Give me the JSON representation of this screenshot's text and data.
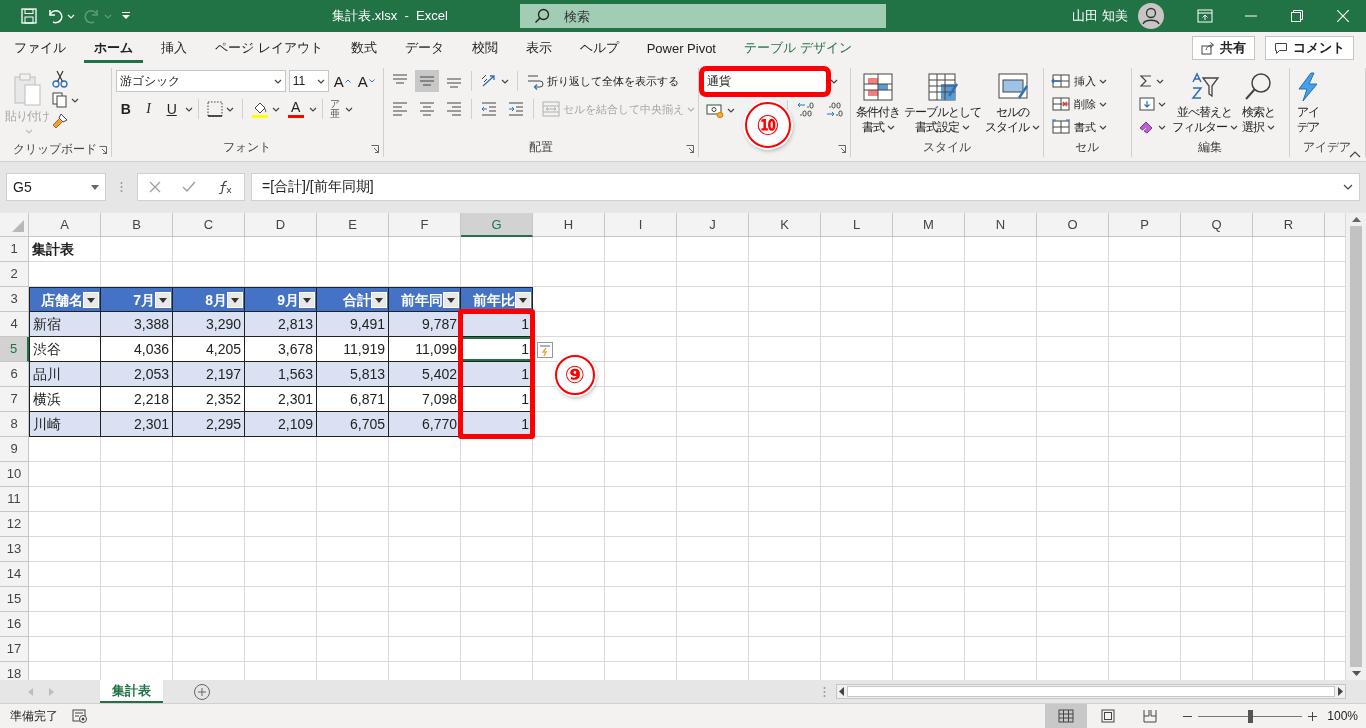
{
  "title_bar": {
    "title": "集計表.xlsx  -  Excel",
    "search_placeholder": "検索",
    "user_name": "山田 知美"
  },
  "menu_tabs": [
    {
      "label": "ファイル",
      "selected": false,
      "kind": "tab"
    },
    {
      "label": "ホーム",
      "selected": true,
      "kind": "tab"
    },
    {
      "label": "挿入",
      "selected": false,
      "kind": "tab"
    },
    {
      "label": "ページ レイアウト",
      "selected": false,
      "kind": "tab"
    },
    {
      "label": "数式",
      "selected": false,
      "kind": "tab"
    },
    {
      "label": "データ",
      "selected": false,
      "kind": "tab"
    },
    {
      "label": "校閲",
      "selected": false,
      "kind": "tab"
    },
    {
      "label": "表示",
      "selected": false,
      "kind": "tab"
    },
    {
      "label": "ヘルプ",
      "selected": false,
      "kind": "tab"
    },
    {
      "label": "Power Pivot",
      "selected": false,
      "kind": "tab"
    },
    {
      "label": "テーブル デザイン",
      "selected": false,
      "kind": "contextual"
    }
  ],
  "share_button": "共有",
  "comment_button": "コメント",
  "ribbon": {
    "clipboard": {
      "paste_label": "貼り付け",
      "paste_disabled": true,
      "group_label": "クリップボード"
    },
    "font": {
      "font_name": "游ゴシック",
      "font_size": "11",
      "grow_label": "A",
      "shrink_label": "A",
      "bold_label": "B",
      "italic_label": "I",
      "underline_label": "U",
      "font_color_label": "A",
      "phonetic_labels": [
        "ア",
        "亜"
      ],
      "group_label": "フォント"
    },
    "alignment": {
      "vertical_buttons": [
        {
          "kind": "top",
          "selected": false
        },
        {
          "kind": "middle",
          "selected": true
        },
        {
          "kind": "bottom",
          "selected": false
        }
      ],
      "wrap_label": "折り返して全体を表示する",
      "merge_label": "セルを結合して中央揃え",
      "merge_disabled": true,
      "group_label": "配置"
    },
    "number": {
      "format": "通貨",
      "highlighted": true
    },
    "styles": {
      "buttons": [
        {
          "kind": "conditional",
          "lines": [
            "条件付き",
            "書式"
          ]
        },
        {
          "kind": "table",
          "lines": [
            "テーブルとして",
            "書式設定"
          ]
        },
        {
          "kind": "cell",
          "lines": [
            "セルの",
            "スタイル"
          ]
        }
      ],
      "group_label": "スタイル"
    },
    "cells": {
      "buttons": [
        {
          "kind": "insert",
          "label": "挿入"
        },
        {
          "kind": "delete",
          "label": "削除"
        },
        {
          "kind": "format",
          "label": "書式"
        }
      ],
      "group_label": "セル"
    },
    "editing": {
      "sort_lines": [
        "並べ替えと",
        "フィルター"
      ],
      "find_lines": [
        "検索と",
        "選択"
      ],
      "group_label": "編集"
    },
    "ideas": {
      "lines": [
        "アイ",
        "デア"
      ],
      "group_label": "アイデア"
    }
  },
  "formula_bar": {
    "name_box": "G5",
    "formula": "=[合計]/[前年同期]"
  },
  "sheet": {
    "columns": [
      {
        "letter": "A",
        "selected": false
      },
      {
        "letter": "B",
        "selected": false
      },
      {
        "letter": "C",
        "selected": false
      },
      {
        "letter": "D",
        "selected": false
      },
      {
        "letter": "E",
        "selected": false
      },
      {
        "letter": "F",
        "selected": false
      },
      {
        "letter": "G",
        "selected": true
      },
      {
        "letter": "H",
        "selected": false
      },
      {
        "letter": "I",
        "selected": false
      },
      {
        "letter": "J",
        "selected": false
      },
      {
        "letter": "K",
        "selected": false
      },
      {
        "letter": "L",
        "selected": false
      },
      {
        "letter": "M",
        "selected": false
      },
      {
        "letter": "N",
        "selected": false
      },
      {
        "letter": "O",
        "selected": false
      },
      {
        "letter": "P",
        "selected": false
      },
      {
        "letter": "Q",
        "selected": false
      },
      {
        "letter": "R",
        "selected": false
      }
    ],
    "rows": [
      {
        "number": "1",
        "selected": false,
        "cells": [
          {
            "kind": "title",
            "text": "集計表",
            "selected": false
          }
        ]
      },
      {
        "number": "2",
        "selected": false
      },
      {
        "number": "3",
        "selected": false,
        "cells": [
          {
            "kind": "header",
            "text": "店舗名",
            "selected": false
          },
          {
            "kind": "header",
            "text": "7月",
            "selected": false
          },
          {
            "kind": "header",
            "text": "8月",
            "selected": false
          },
          {
            "kind": "header",
            "text": "9月",
            "selected": false
          },
          {
            "kind": "header",
            "text": "合計",
            "selected": false
          },
          {
            "kind": "header",
            "text": "前年同",
            "selected": false
          },
          {
            "kind": "header",
            "text": "前年比",
            "selected": false
          }
        ]
      },
      {
        "number": "4",
        "selected": false,
        "banded": true,
        "cells": [
          {
            "kind": "text",
            "text": "新宿",
            "selected": false
          },
          {
            "kind": "number",
            "text": "3,388",
            "selected": false
          },
          {
            "kind": "number",
            "text": "3,290",
            "selected": false
          },
          {
            "kind": "number",
            "text": "2,813",
            "selected": false
          },
          {
            "kind": "number",
            "text": "9,491",
            "selected": false
          },
          {
            "kind": "number",
            "text": "9,787",
            "selected": false
          },
          {
            "kind": "number",
            "text": "1",
            "selected": false
          }
        ]
      },
      {
        "number": "5",
        "selected": true,
        "banded": false,
        "cells": [
          {
            "kind": "text",
            "text": "渋谷",
            "selected": false
          },
          {
            "kind": "number",
            "text": "4,036",
            "selected": false
          },
          {
            "kind": "number",
            "text": "4,205",
            "selected": false
          },
          {
            "kind": "number",
            "text": "3,678",
            "selected": false
          },
          {
            "kind": "number",
            "text": "11,919",
            "selected": false
          },
          {
            "kind": "number",
            "text": "11,099",
            "selected": false
          },
          {
            "kind": "number",
            "text": "1",
            "selected": true
          }
        ]
      },
      {
        "number": "6",
        "selected": false,
        "banded": true,
        "cells": [
          {
            "kind": "text",
            "text": "品川",
            "selected": false
          },
          {
            "kind": "number",
            "text": "2,053",
            "selected": false
          },
          {
            "kind": "number",
            "text": "2,197",
            "selected": false
          },
          {
            "kind": "number",
            "text": "1,563",
            "selected": false
          },
          {
            "kind": "number",
            "text": "5,813",
            "selected": false
          },
          {
            "kind": "number",
            "text": "5,402",
            "selected": false
          },
          {
            "kind": "number",
            "text": "1",
            "selected": false
          }
        ]
      },
      {
        "number": "7",
        "selected": false,
        "banded": false,
        "cells": [
          {
            "kind": "text",
            "text": "横浜",
            "selected": false
          },
          {
            "kind": "number",
            "text": "2,218",
            "selected": false
          },
          {
            "kind": "number",
            "text": "2,352",
            "selected": false
          },
          {
            "kind": "number",
            "text": "2,301",
            "selected": false
          },
          {
            "kind": "number",
            "text": "6,871",
            "selected": false
          },
          {
            "kind": "number",
            "text": "7,098",
            "selected": false
          },
          {
            "kind": "number",
            "text": "1",
            "selected": false
          }
        ]
      },
      {
        "number": "8",
        "selected": false,
        "banded": true,
        "cells": [
          {
            "kind": "text",
            "text": "川崎",
            "selected": false
          },
          {
            "kind": "number",
            "text": "2,301",
            "selected": false
          },
          {
            "kind": "number",
            "text": "2,295",
            "selected": false
          },
          {
            "kind": "number",
            "text": "2,109",
            "selected": false
          },
          {
            "kind": "number",
            "text": "6,705",
            "selected": false
          },
          {
            "kind": "number",
            "text": "6,770",
            "selected": false
          },
          {
            "kind": "number",
            "text": "1",
            "selected": false
          }
        ]
      },
      {
        "number": "9",
        "selected": false
      },
      {
        "number": "10",
        "selected": false
      },
      {
        "number": "11",
        "selected": false
      },
      {
        "number": "12",
        "selected": false
      },
      {
        "number": "13",
        "selected": false
      },
      {
        "number": "14",
        "selected": false
      },
      {
        "number": "15",
        "selected": false
      },
      {
        "number": "16",
        "selected": false
      },
      {
        "number": "17",
        "selected": false
      },
      {
        "number": "18",
        "selected": false
      }
    ]
  },
  "annotations": [
    {
      "label": "⑩",
      "kind": "ribbon"
    },
    {
      "label": "⑨",
      "kind": "sheet"
    }
  ],
  "sheet_tabs": [
    {
      "label": "集計表",
      "selected": true
    }
  ],
  "status_bar": {
    "status": "準備完了",
    "views": [
      {
        "kind": "normal",
        "selected": true
      },
      {
        "kind": "page-layout",
        "selected": false
      },
      {
        "kind": "page-break",
        "selected": false
      }
    ],
    "zoom": {
      "level": 0.5,
      "reading": "100%"
    }
  }
}
